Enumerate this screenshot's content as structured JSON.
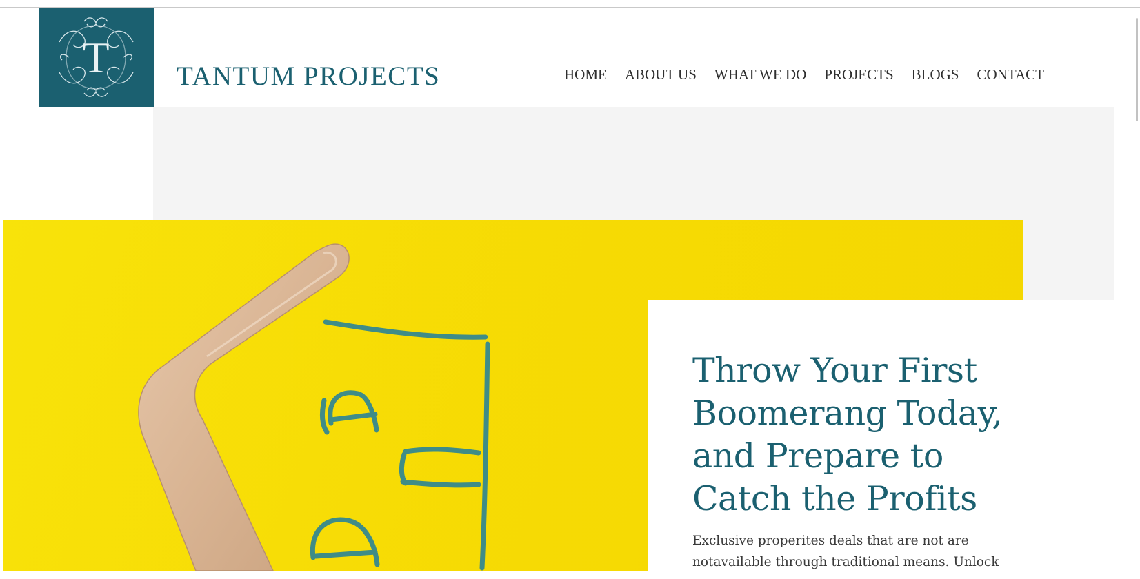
{
  "header": {
    "logo_letter": "T",
    "brand_name": "TANTUM PROJECTS",
    "brand_color": "#1b6070"
  },
  "nav": {
    "items": [
      {
        "label": "HOME"
      },
      {
        "label": "ABOUT US"
      },
      {
        "label": "WHAT WE DO"
      },
      {
        "label": "PROJECTS"
      },
      {
        "label": "BLOGS"
      },
      {
        "label": "CONTACT"
      }
    ]
  },
  "hero": {
    "image_icon": "boomerang-house-sketch",
    "background_color": "#f7dc05",
    "sketch_color": "#3f8c87"
  },
  "card": {
    "title": "Throw Your First Boomerang Today, and Prepare to Catch the Profits",
    "description": "Exclusive properites deals that are not are notavailable through traditional means. Unlock"
  }
}
